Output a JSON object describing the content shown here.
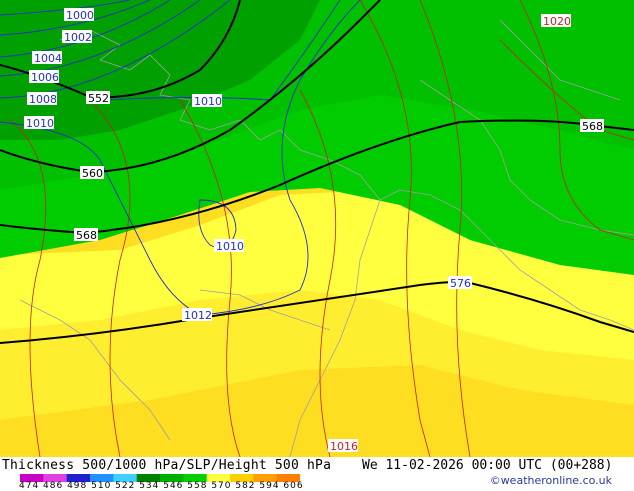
{
  "footer": {
    "title": "Thickness 500/1000 hPa/SLP/Height 500 hPa",
    "datetime": "We 11-02-2026 00:00 UTC (00+288)",
    "credit": "©weatheronline.co.uk",
    "legend_ticks": "474 486 498 510 522 534 546 558 570 582 594 606",
    "legend_colors": [
      "#c800c8",
      "#e040e0",
      "#2020d0",
      "#2090ff",
      "#40d0ff",
      "#008000",
      "#00b000",
      "#00d000",
      "#ffff40",
      "#ffd000",
      "#ffa000",
      "#ff8000"
    ]
  },
  "map": {
    "colors": {
      "dark_green": "#00a000",
      "mid_green": "#00c000",
      "light_green": "#00cc00",
      "pale_yellow": "#ffff40",
      "yellow": "#ffee30",
      "deep_yellow": "#ffdd20",
      "slp_contour": "#2030c8",
      "thickness_contour": "#c82020",
      "height_contour": "#000000",
      "coast": "#a0a0a0"
    },
    "height_labels": [
      "552",
      "560",
      "568",
      "568",
      "576"
    ],
    "slp_labels": [
      "1000",
      "1002",
      "1004",
      "1006",
      "1008",
      "1010",
      "1010",
      "1010",
      "1012",
      "1016",
      "1020"
    ]
  }
}
